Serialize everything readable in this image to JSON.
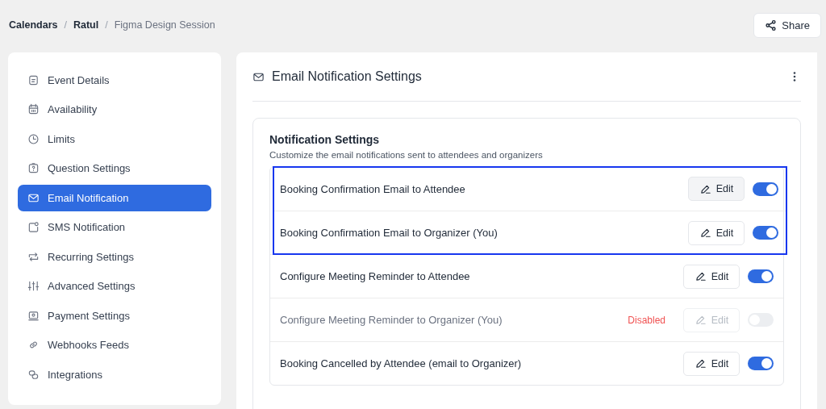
{
  "breadcrumb": [
    {
      "label": "Calendars",
      "current": false
    },
    {
      "label": "Ratul",
      "current": false
    },
    {
      "label": "Figma Design Session",
      "current": true
    }
  ],
  "breadcrumb_separator": "/",
  "share_button": {
    "label": "Share"
  },
  "sidebar": {
    "items": [
      {
        "label": "Event Details",
        "selected": false
      },
      {
        "label": "Availability",
        "selected": false
      },
      {
        "label": "Limits",
        "selected": false
      },
      {
        "label": "Question Settings",
        "selected": false
      },
      {
        "label": "Email Notification",
        "selected": true
      },
      {
        "label": "SMS Notification",
        "selected": false
      },
      {
        "label": "Recurring Settings",
        "selected": false
      },
      {
        "label": "Advanced Settings",
        "selected": false
      },
      {
        "label": "Payment Settings",
        "selected": false
      },
      {
        "label": "Webhooks Feeds",
        "selected": false
      },
      {
        "label": "Integrations",
        "selected": false
      }
    ]
  },
  "panel": {
    "title": "Email Notification Settings",
    "section": {
      "title": "Notification Settings",
      "description": "Customize the email notifications sent to attendees and organizers",
      "rows": [
        {
          "label": "Booking Confirmation Email to Attendee",
          "edit": "Edit",
          "on": true,
          "disabled": false,
          "highlighted": true,
          "hovered": true
        },
        {
          "label": "Booking Confirmation Email to Organizer (You)",
          "edit": "Edit",
          "on": true,
          "disabled": false,
          "highlighted": true,
          "hovered": false
        },
        {
          "label": "Configure Meeting Reminder to Attendee",
          "edit": "Edit",
          "on": true,
          "disabled": false,
          "highlighted": false,
          "hovered": false
        },
        {
          "label": "Configure Meeting Reminder to Organizer (You)",
          "edit": "Edit",
          "on": false,
          "disabled": true,
          "status": "Disabled",
          "highlighted": false,
          "hovered": false
        },
        {
          "label": "Booking Cancelled by Attendee (email to Organizer)",
          "edit": "Edit",
          "on": true,
          "disabled": false,
          "highlighted": false,
          "hovered": false
        }
      ]
    }
  }
}
